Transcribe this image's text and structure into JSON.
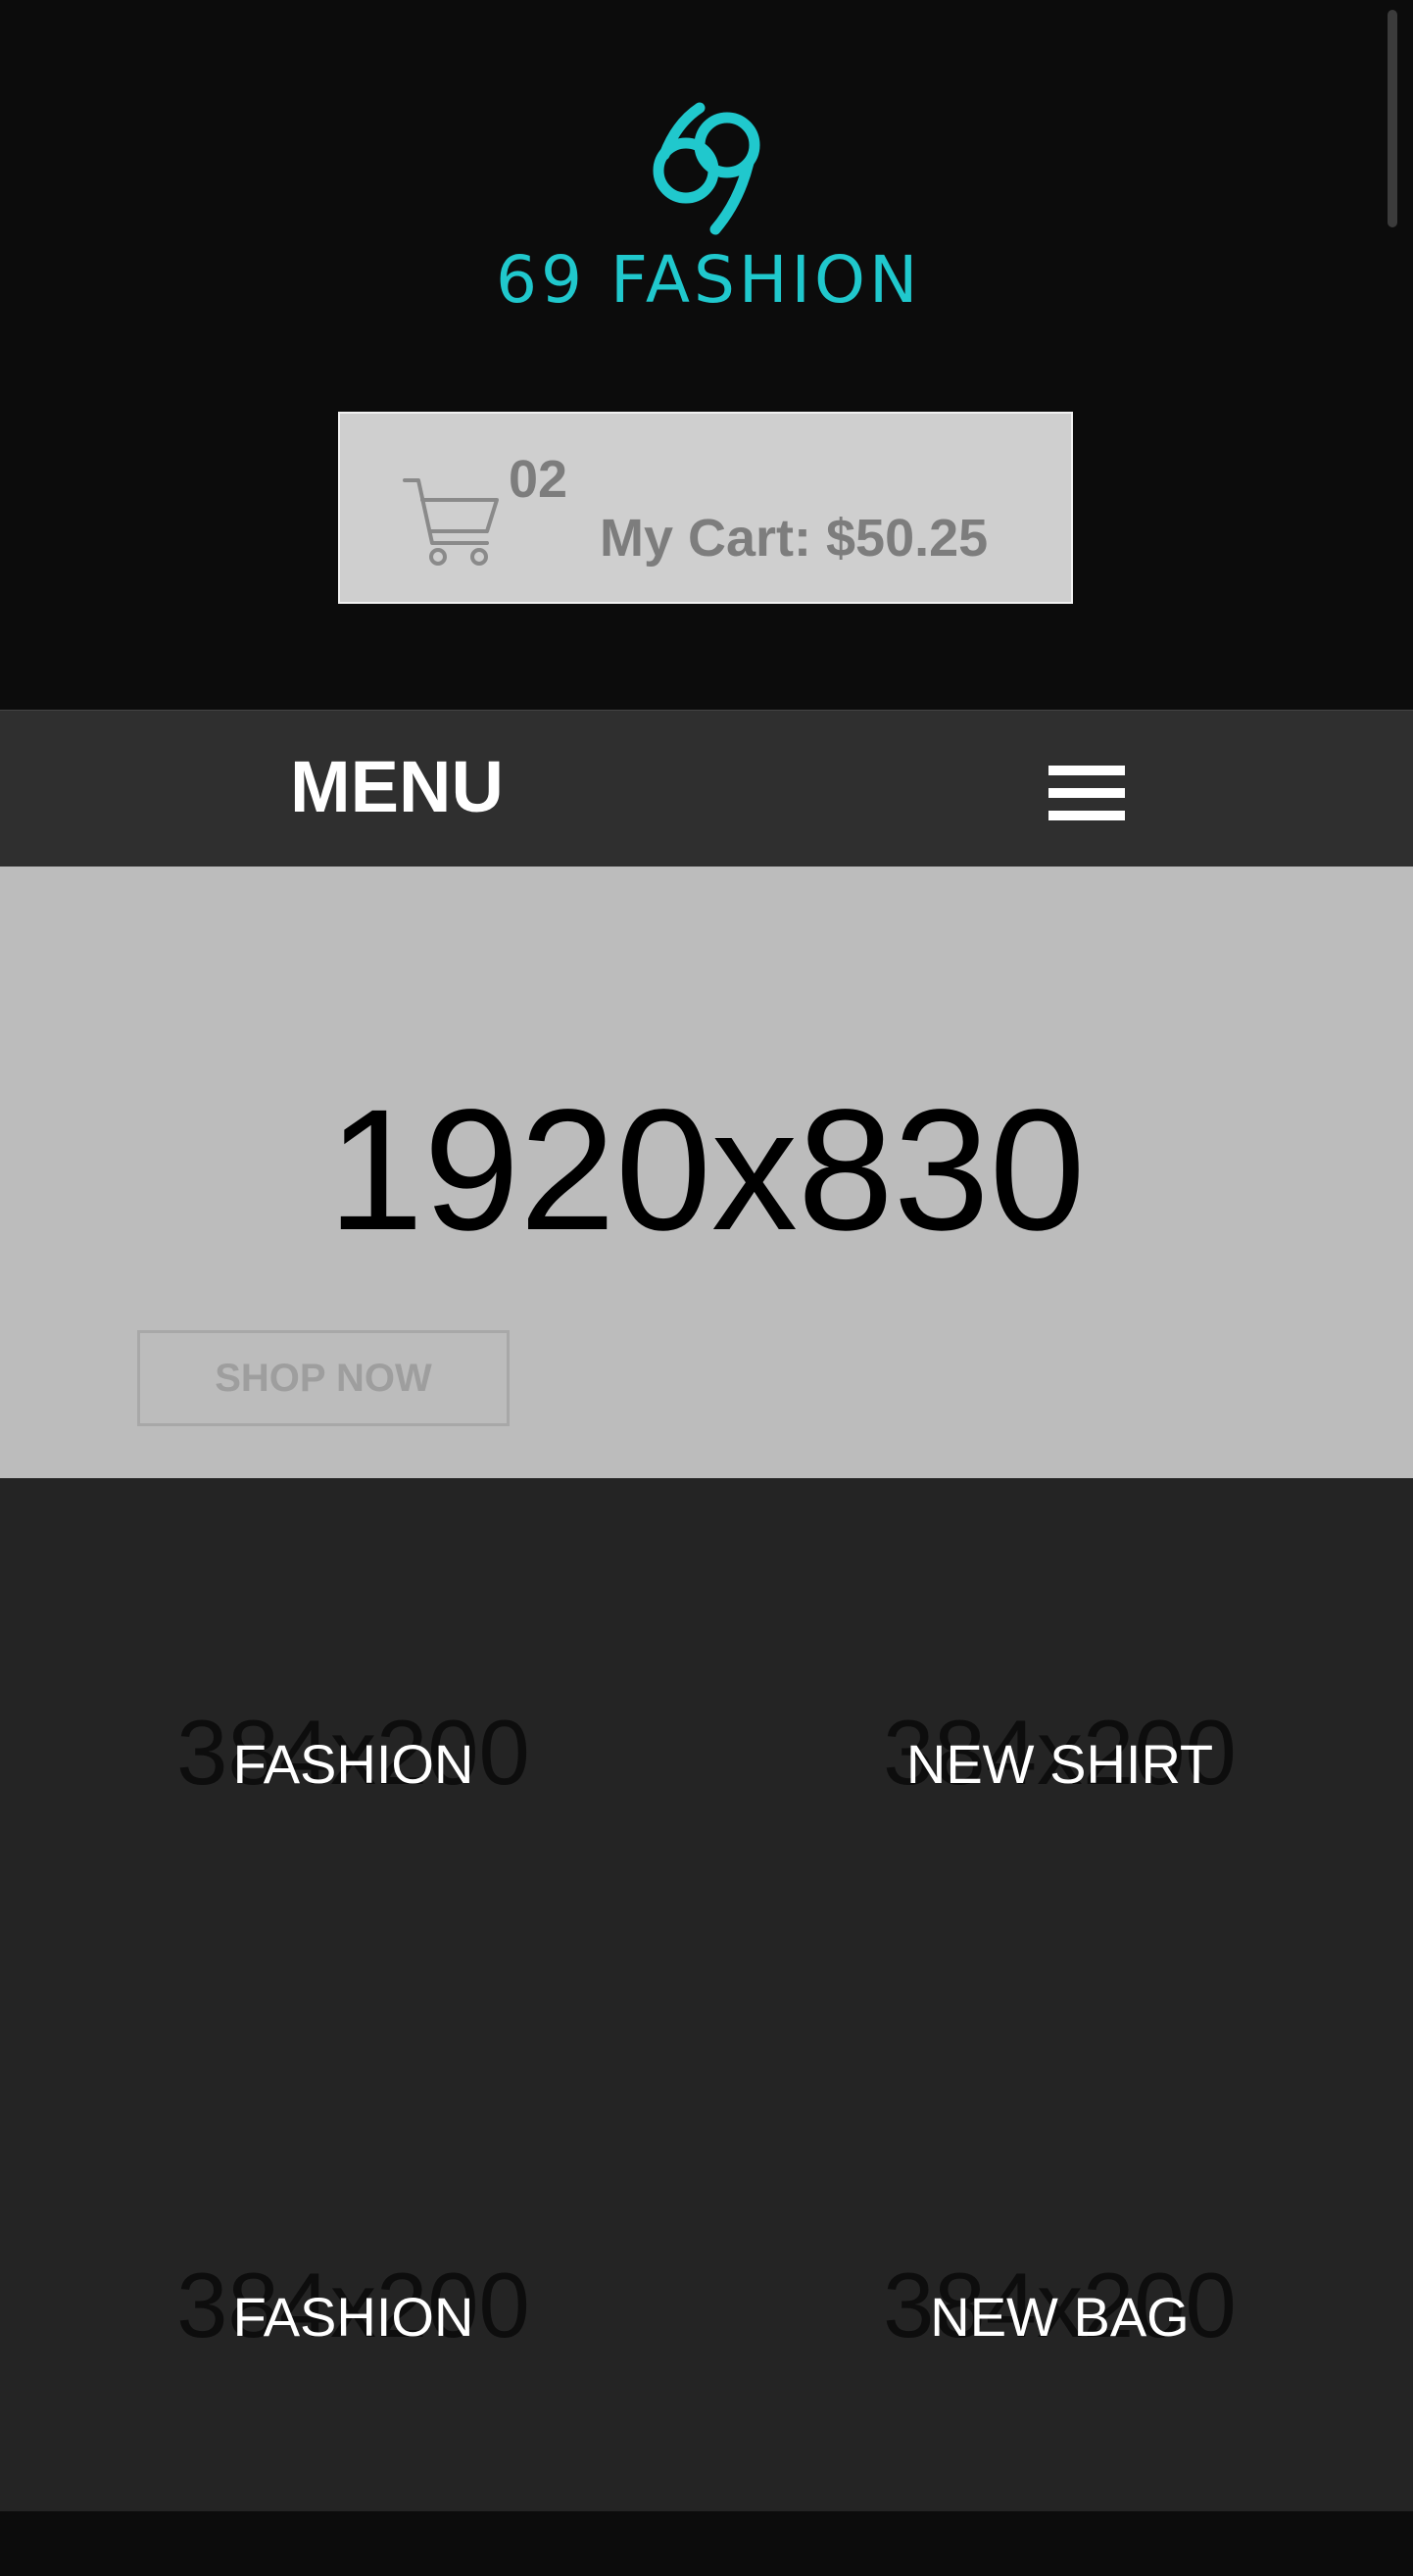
{
  "brand": {
    "logo_text": "69 FASHION",
    "logo_color": "#20c8cd"
  },
  "cart": {
    "count": "02",
    "label": "My Cart: $50.25",
    "icon": "cart-icon"
  },
  "menu": {
    "label": "MENU",
    "icon": "hamburger-icon"
  },
  "hero": {
    "placeholder": "1920x830",
    "cta_label": "SHOP NOW"
  },
  "categories": [
    {
      "placeholder": "384x200",
      "label": "FASHION"
    },
    {
      "placeholder": "384x200",
      "label": "NEW SHIRT"
    },
    {
      "placeholder": "384x200",
      "label": "FASHION"
    },
    {
      "placeholder": "384x200",
      "label": "NEW BAG"
    }
  ],
  "colors": {
    "header_bg": "#0c0c0c",
    "menu_bg": "#2f2f2f",
    "hero_bg": "#bcbcbc",
    "category_bg": "#242424",
    "cart_bg": "#cfcfcf"
  }
}
